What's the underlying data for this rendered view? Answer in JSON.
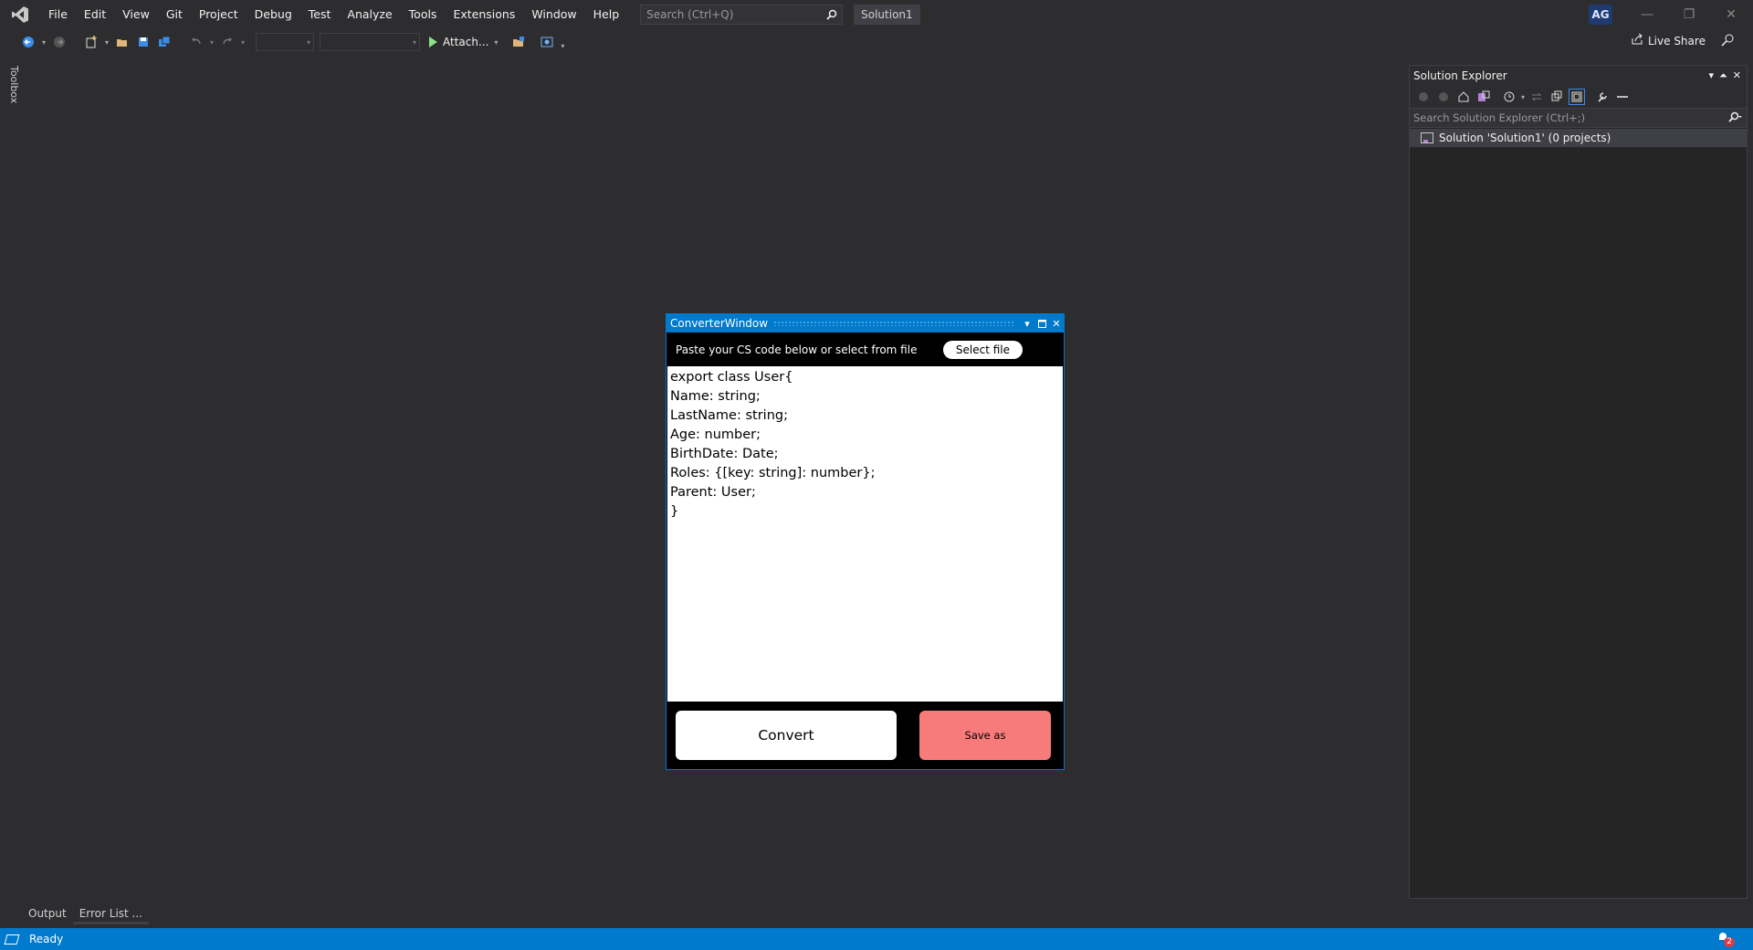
{
  "menubar": {
    "items": [
      "File",
      "Edit",
      "View",
      "Git",
      "Project",
      "Debug",
      "Test",
      "Analyze",
      "Tools",
      "Extensions",
      "Window",
      "Help"
    ],
    "search_placeholder": "Search (Ctrl+Q)",
    "solution_name": "Solution1",
    "avatar_initials": "AG"
  },
  "toolbar": {
    "attach_label": "Attach...",
    "live_share_label": "Live Share"
  },
  "toolbox": {
    "label": "Toolbox"
  },
  "solution_explorer": {
    "title": "Solution Explorer",
    "search_placeholder": "Search Solution Explorer (Ctrl+;)",
    "tree_item": "Solution 'Solution1' (0 projects)"
  },
  "converter": {
    "title": "ConverterWindow",
    "instruction": "Paste your CS code below or select from file",
    "select_file_label": "Select file",
    "code": "export class User{\nName: string;\nLastName: string;\nAge: number;\nBirthDate: Date;\nRoles: {[key: string]: number};\nParent: User;\n}",
    "convert_label": "Convert",
    "save_as_label": "Save as"
  },
  "bottom_tabs": [
    "Output",
    "Error List ..."
  ],
  "status": {
    "text": "Ready",
    "notification_count": "2"
  },
  "colors": {
    "accent": "#007acc",
    "background": "#2d2d30",
    "save_button": "#f77b7b"
  }
}
